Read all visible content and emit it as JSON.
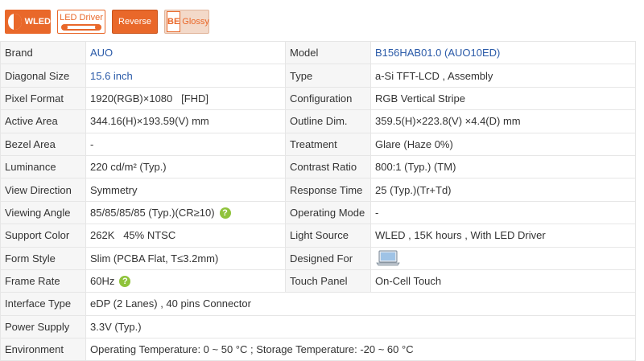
{
  "badges": {
    "wled": "WLED",
    "led_driver": "LED Driver",
    "reverse": "Reverse",
    "glossy": "Glossy",
    "glossy_mark": "BE"
  },
  "specs": {
    "brand_label": "Brand",
    "brand": "AUO",
    "model_label": "Model",
    "model": "B156HAB01.0 (AUO10ED)",
    "diagonal_label": "Diagonal Size",
    "diagonal": "15.6 inch",
    "type_label": "Type",
    "type": "a-Si TFT-LCD , Assembly",
    "pixel_label": "Pixel Format",
    "pixel": "1920(RGB)×1080   [FHD]",
    "config_label": "Configuration",
    "config": "RGB Vertical Stripe",
    "active_label": "Active Area",
    "active": "344.16(H)×193.59(V) mm",
    "outline_label": "Outline Dim.",
    "outline": "359.5(H)×223.8(V) ×4.4(D) mm",
    "bezel_label": "Bezel Area",
    "bezel": "-",
    "treatment_label": "Treatment",
    "treatment": "Glare (Haze 0%)",
    "luminance_label": "Luminance",
    "luminance": "220 cd/m² (Typ.)",
    "contrast_label": "Contrast Ratio",
    "contrast": "800:1 (Typ.) (TM)",
    "viewdir_label": "View Direction",
    "viewdir": "Symmetry",
    "response_label": "Response Time",
    "response": "25 (Typ.)(Tr+Td)",
    "viewangle_label": "Viewing Angle",
    "viewangle": "85/85/85/85 (Typ.)(CR≥10)",
    "opmode_label": "Operating Mode",
    "opmode": "-",
    "color_label": "Support Color",
    "color": "262K   45% NTSC",
    "light_label": "Light Source",
    "light": "WLED , 15K hours , With LED Driver",
    "form_label": "Form Style",
    "form": "Slim (PCBA Flat, T≤3.2mm)",
    "designed_label": "Designed For",
    "frame_label": "Frame Rate",
    "frame": "60Hz",
    "touch_label": "Touch Panel",
    "touch": "On-Cell Touch",
    "interface_label": "Interface Type",
    "interface": "eDP (2 Lanes) , 40 pins Connector",
    "power_label": "Power Supply",
    "power": "3.3V (Typ.)",
    "env_label": "Environment",
    "env": "Operating Temperature: 0 ~ 50 °C ; Storage Temperature: -20 ~ 60 °C"
  },
  "icons": {
    "info": "info-icon",
    "laptop": "laptop-icon"
  },
  "colors": {
    "accent": "#e9682a",
    "link": "#2a5aa8",
    "info": "#8fc33b"
  }
}
